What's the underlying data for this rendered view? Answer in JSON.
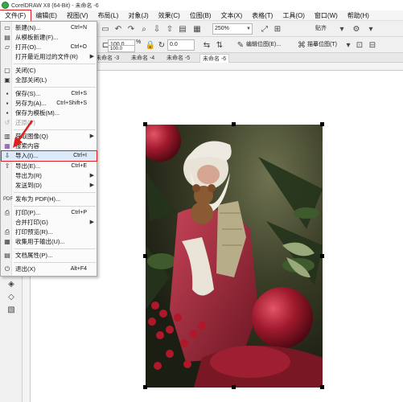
{
  "app": {
    "title": "CorelDRAW X8 (64-Bit) - 未命名 -6"
  },
  "menubar": {
    "items": [
      "文件(F)",
      "编辑(E)",
      "视图(V)",
      "布局(L)",
      "对象(J)",
      "效果(C)",
      "位图(B)",
      "文本(X)",
      "表格(T)",
      "工具(O)",
      "窗口(W)",
      "帮助(H)"
    ]
  },
  "toolbar": {
    "zoom_value": "250%",
    "snap_label": "贴齐",
    "edit_bitmap_label": "编辑位图(E)...",
    "trace_bitmap_label": "描摹位图(T)"
  },
  "propbar": {
    "width_value": "100.0",
    "height_value": "100.0",
    "percent_unit": "%",
    "angle_value": "0.0"
  },
  "tabs": [
    "未命名 -3",
    "未命名 -4",
    "未命名 -5",
    "未命名 -6"
  ],
  "file_menu": {
    "items": [
      {
        "label": "新建(N)...",
        "shortcut": "Ctrl+N",
        "icon": "new-doc-icon"
      },
      {
        "label": "从模板新建(F)...",
        "shortcut": "",
        "icon": "template-icon"
      },
      {
        "label": "打开(O)...",
        "shortcut": "Ctrl+O",
        "icon": "open-folder-icon"
      },
      {
        "label": "打开最近用过的文件(R)",
        "shortcut": "",
        "icon": "",
        "submenu": true
      },
      {
        "label": "关闭(C)",
        "shortcut": "",
        "icon": "close-doc-icon"
      },
      {
        "label": "全部关闭(L)",
        "shortcut": "",
        "icon": "close-all-icon"
      },
      {
        "label": "保存(S)...",
        "shortcut": "Ctrl+S",
        "icon": "save-icon"
      },
      {
        "label": "另存为(A)...",
        "shortcut": "Ctrl+Shift+S",
        "icon": "save-as-icon"
      },
      {
        "label": "保存为模板(M)...",
        "shortcut": "",
        "icon": "save-template-icon"
      },
      {
        "label": "还原(V)",
        "shortcut": "",
        "icon": "revert-icon",
        "disabled": true
      },
      {
        "label": "获取图像(Q)",
        "shortcut": "",
        "icon": "acquire-icon",
        "submenu": true
      },
      {
        "label": "搜索内容",
        "shortcut": "",
        "icon": "search-content-icon"
      },
      {
        "label": "导入(I)...",
        "shortcut": "Ctrl+I",
        "icon": "import-icon"
      },
      {
        "label": "导出(E)...",
        "shortcut": "Ctrl+E",
        "icon": "export-icon"
      },
      {
        "label": "导出为(R)",
        "shortcut": "",
        "icon": "",
        "submenu": true
      },
      {
        "label": "发送到(D)",
        "shortcut": "",
        "icon": "",
        "submenu": true
      },
      {
        "label": "发布为 PDF(H)...",
        "shortcut": "",
        "icon": "pdf-icon"
      },
      {
        "label": "打印(P)...",
        "shortcut": "Ctrl+P",
        "icon": "print-icon"
      },
      {
        "label": "合并打印(G)",
        "shortcut": "",
        "icon": "",
        "submenu": true
      },
      {
        "label": "打印预览(R)...",
        "shortcut": "",
        "icon": "print-preview-icon"
      },
      {
        "label": "收集用于输出(U)...",
        "shortcut": "",
        "icon": "collect-output-icon"
      },
      {
        "label": "文档属性(P)...",
        "shortcut": "",
        "icon": "doc-properties-icon"
      },
      {
        "label": "退出(X)",
        "shortcut": "Alt+F4",
        "icon": "exit-icon"
      }
    ]
  },
  "colors": {
    "highlight_border": "#e02020",
    "highlight_fill": "#dbe9f8"
  }
}
